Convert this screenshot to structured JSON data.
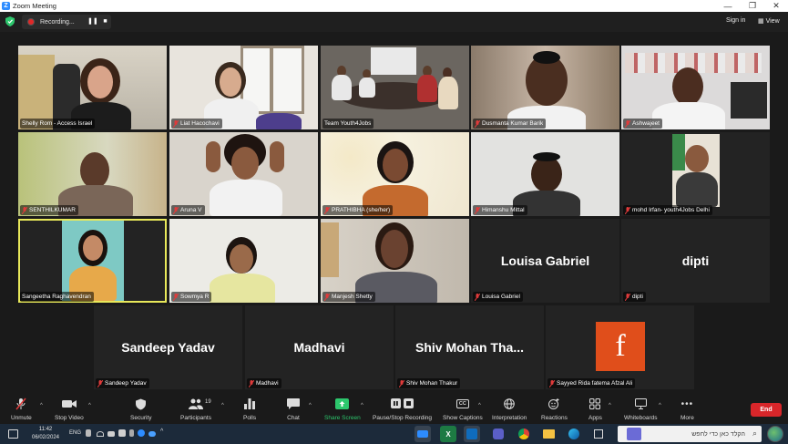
{
  "window": {
    "title": "Zoom Meeting",
    "controls": {
      "minimize": "—",
      "maximize": "❐",
      "close": "✕"
    }
  },
  "topbar": {
    "recording_label": "Recording...",
    "sign_in": "Sign in",
    "view": "View"
  },
  "participants": [
    {
      "name": "Shelly Rom - Access Israel",
      "video": true
    },
    {
      "name": "Liat Hacochavi",
      "video": true
    },
    {
      "name": "Team Youth4Jobs",
      "video": true
    },
    {
      "name": "Dusmanta Kumar Barik",
      "video": true
    },
    {
      "name": "Ashwajeet",
      "video": true
    },
    {
      "name": "SENTHILKUMAR",
      "video": true
    },
    {
      "name": "Aruna V",
      "video": true
    },
    {
      "name": "PRATHIBHA (she/her)",
      "video": true
    },
    {
      "name": "Himanshu Mittal",
      "video": true
    },
    {
      "name": "mohd Irfan- youth4Jobs Delhi",
      "video": true
    },
    {
      "name": "Sangeetha Raghavendran",
      "video": true,
      "active_speaker": true
    },
    {
      "name": "Sowmya R",
      "video": true
    },
    {
      "name": "Manjesh Shetty",
      "video": true
    },
    {
      "name": "Louisa Gabriel",
      "video": false,
      "display_name": "Louisa Gabriel"
    },
    {
      "name": "dipti",
      "video": false,
      "display_name": "dipti"
    },
    {
      "name": "Sandeep Yadav",
      "video": false,
      "display_name": "Sandeep Yadav"
    },
    {
      "name": "Madhavi",
      "video": false,
      "display_name": "Madhavi"
    },
    {
      "name": "Shiv Mohan Thakur",
      "video": false,
      "display_name": "Shiv Mohan Tha..."
    },
    {
      "name": "Sayyed Rida fatema Afzal Ali",
      "video": false,
      "avatar_letter": "f",
      "avatar_color": "#e04e1b"
    }
  ],
  "toolbar": {
    "unmute": "Unmute",
    "stop_video": "Stop Video",
    "security": "Security",
    "participants": "Participants",
    "participants_count": "19",
    "polls": "Polls",
    "chat": "Chat",
    "share_screen": "Share Screen",
    "pause_stop_recording": "Pause/Stop Recording",
    "show_captions": "Show Captions",
    "interpretation": "Interpretation",
    "reactions": "Reactions",
    "apps": "Apps",
    "whiteboards": "Whiteboards",
    "more": "More",
    "end": "End",
    "cc_icon_text": "CC"
  },
  "taskbar": {
    "time": "11:42",
    "date": "06/02/2024",
    "lang": "ENG",
    "search_text": "הקלד כאן כדי לחפש"
  },
  "colors": {
    "accent_green": "#2dc76d",
    "end_red": "#d8262a",
    "active_speaker": "#e8e85a",
    "zoom_blue": "#2d8cff"
  }
}
